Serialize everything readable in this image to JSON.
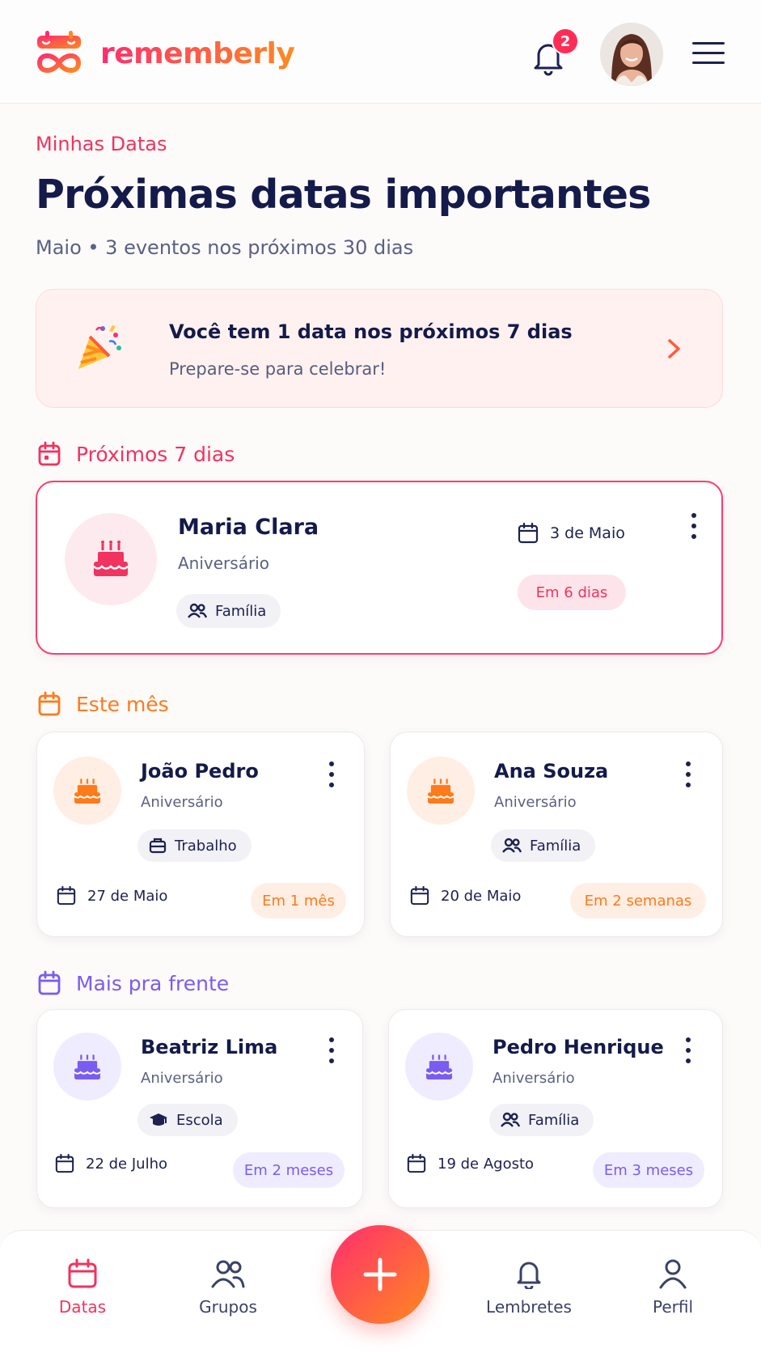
{
  "app": {
    "brand": "rememberly"
  },
  "header": {
    "notification_count": "2"
  },
  "page": {
    "eyebrow": "Minhas Datas",
    "title": "Próximas datas importantes",
    "subtitle": "Maio • 3 eventos nos próximos 30 dias"
  },
  "banner": {
    "title": "Você tem 1 data nos próximos 7 dias",
    "subtitle": "Prepare-se para celebrar!"
  },
  "sections": {
    "next7": {
      "label": "Próximos 7 dias",
      "color": "#f2325f"
    },
    "month": {
      "label": "Este mês",
      "color": "#ff7a1a"
    },
    "later": {
      "label": "Mais pra frente",
      "color": "#7a5cf0"
    }
  },
  "events": {
    "maria": {
      "name": "Maria Clara",
      "type": "Aniversário",
      "group": "Família",
      "date": "3 de Maio",
      "countdown": "Em 6 dias"
    },
    "joao": {
      "name": "João Pedro",
      "type": "Aniversário",
      "group": "Trabalho",
      "date": "27 de Maio",
      "countdown": "Em 1 mês"
    },
    "ana": {
      "name": "Ana Souza",
      "type": "Aniversário",
      "group": "Família",
      "date": "20 de Maio",
      "countdown": "Em 2 semanas"
    },
    "beatriz": {
      "name": "Beatriz Lima",
      "type": "Aniversário",
      "group": "Escola",
      "date": "22 de Julho",
      "countdown": "Em 2 meses"
    },
    "pedro": {
      "name": "Pedro Henrique",
      "type": "Aniversário",
      "group": "Família",
      "date": "19 de Agosto",
      "countdown": "Em 3 meses"
    }
  },
  "nav": {
    "datas": "Datas",
    "grupos": "Grupos",
    "lembretes": "Lembretes",
    "perfil": "Perfil"
  },
  "icons": {
    "logo": "infinity-calendar-icon",
    "bell": "bell-icon",
    "menu": "hamburger-menu-icon",
    "party": "party-popper-icon",
    "cake": "birthday-cake-icon",
    "family": "people-icon",
    "work": "briefcase-icon",
    "school": "graduation-cap-icon",
    "calendar": "calendar-icon",
    "add": "plus-icon"
  },
  "colors": {
    "accent_pink": "#f2325f",
    "accent_orange": "#ff7a1a",
    "accent_purple": "#7a5cf0",
    "navy_text": "#141a4a"
  }
}
